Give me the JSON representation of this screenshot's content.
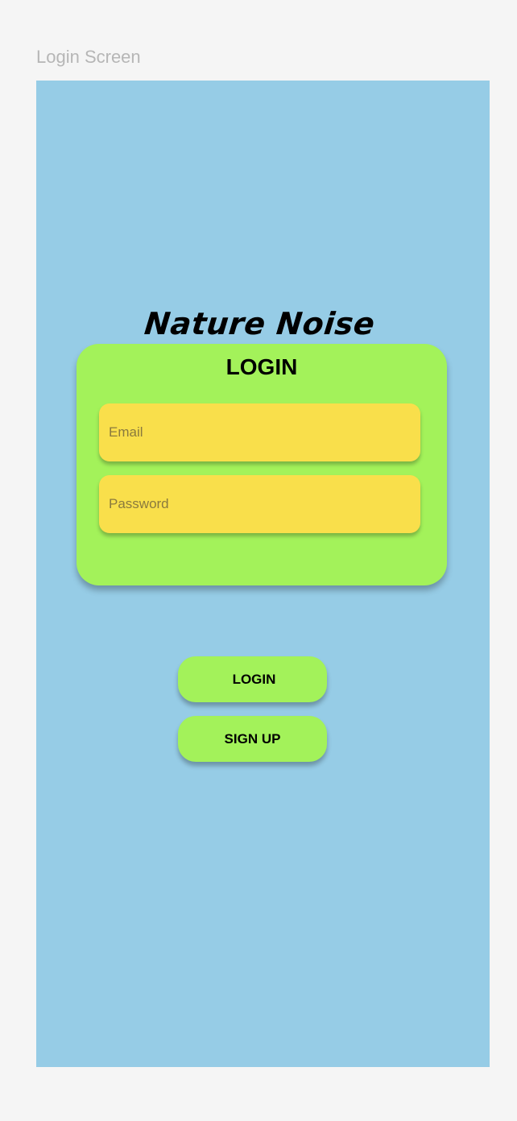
{
  "frame": {
    "label": "Login Screen",
    "background": "#96cce6"
  },
  "app": {
    "title": "Nature Noise"
  },
  "login_card": {
    "heading": "LOGIN",
    "background": "#a3f25a",
    "email": {
      "placeholder": "Email",
      "value": ""
    },
    "password": {
      "placeholder": "Password",
      "value": ""
    },
    "field_color": "#f9df4b"
  },
  "actions": {
    "login_label": "LOGIN",
    "signup_label": "SIGN UP"
  }
}
